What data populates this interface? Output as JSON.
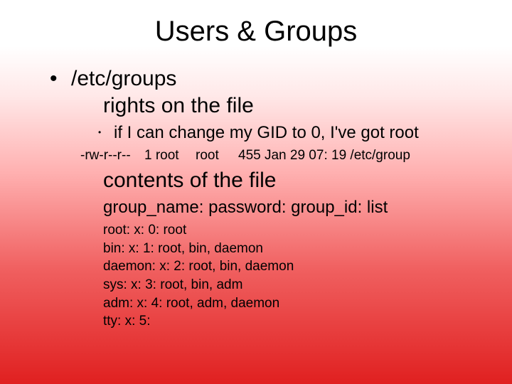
{
  "title": "Users & Groups",
  "main_bullet": "/etc/groups",
  "rights_heading": "rights on the file",
  "sub_bullet": "if I can change my GID to 0, I've got  root",
  "perm": {
    "perms": "-rw-r--r--",
    "links_owner": "1 root",
    "group": "root",
    "rest": "455 Jan 29 07: 19 /etc/group"
  },
  "contents_heading": "contents of the file",
  "format": "group_name: password: group_id: list",
  "entries": [
    "root: x: 0: root",
    "bin: x: 1: root, bin, daemon",
    "daemon: x: 2: root, bin, daemon",
    "sys: x: 3: root, bin, adm",
    "adm: x: 4: root, adm, daemon",
    "tty: x: 5:"
  ]
}
